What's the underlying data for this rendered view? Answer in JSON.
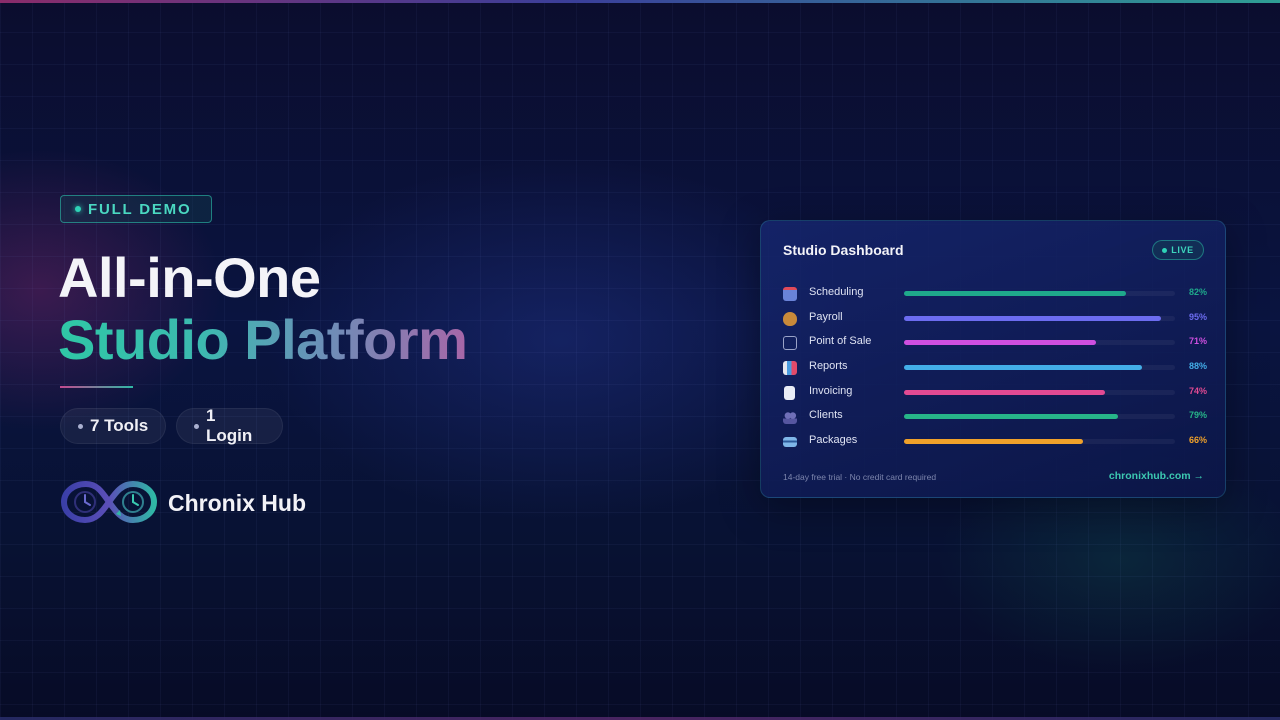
{
  "hero": {
    "badge": "FULL DEMO",
    "title_line1": "All-in-One",
    "title_line2": "Studio Platform",
    "pills": [
      "7 Tools",
      "1 Login"
    ],
    "brand": "Chronix Hub"
  },
  "dashboard": {
    "title": "Studio Dashboard",
    "status": "LIVE",
    "rows": [
      {
        "label": "Scheduling",
        "icon": "calendar-icon",
        "percent": "82%",
        "value": 0.82,
        "color": "#1fa98b"
      },
      {
        "label": "Payroll",
        "icon": "money-bag-icon",
        "percent": "95%",
        "value": 0.95,
        "color": "#6c6cf0"
      },
      {
        "label": "Point of Sale",
        "icon": "cart-icon",
        "percent": "71%",
        "value": 0.71,
        "color": "#cf4fe0"
      },
      {
        "label": "Reports",
        "icon": "bar-chart-icon",
        "percent": "88%",
        "value": 0.88,
        "color": "#43aee8"
      },
      {
        "label": "Invoicing",
        "icon": "document-icon",
        "percent": "74%",
        "value": 0.74,
        "color": "#e24a93"
      },
      {
        "label": "Clients",
        "icon": "people-icon",
        "percent": "79%",
        "value": 0.79,
        "color": "#27b589"
      },
      {
        "label": "Packages",
        "icon": "card-icon",
        "percent": "66%",
        "value": 0.66,
        "color": "#f0a12a"
      }
    ],
    "footer_note": "14-day free trial · No credit card required",
    "footer_link": "chronixhub.com →"
  },
  "colors": {
    "accent_teal": "#2ed3b7",
    "accent_pink": "#c24a8f",
    "background": "#0a1440"
  }
}
